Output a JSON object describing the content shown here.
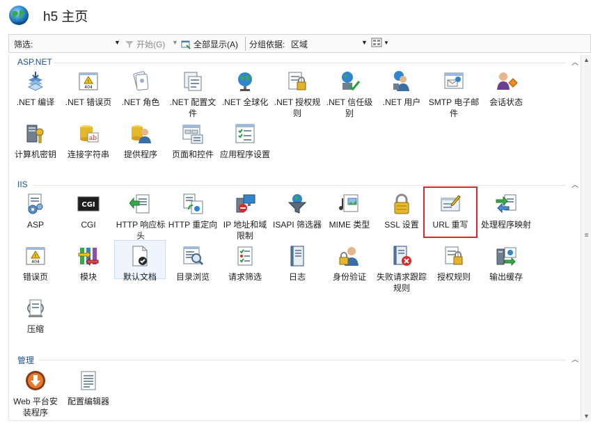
{
  "header": {
    "title": "h5 主页",
    "icon": "globe-icon"
  },
  "toolbar": {
    "filter_label": "筛选:",
    "filter_value": "",
    "start_label": "开始(G)",
    "show_all_label": "全部显示(A)",
    "group_by_label": "分组依据:",
    "group_by_value": "区域",
    "view_icon": "view-toggle-icon"
  },
  "sections": [
    {
      "title": "ASP.NET",
      "items": [
        {
          "label": ".NET 编译",
          "icon": "compile-icon"
        },
        {
          "label": ".NET 错误页",
          "icon": "error-404-icon"
        },
        {
          "label": ".NET 角色",
          "icon": "roles-icon"
        },
        {
          "label": ".NET 配置文件",
          "icon": "profile-icon"
        },
        {
          "label": ".NET 全球化",
          "icon": "globalization-icon"
        },
        {
          "label": ".NET 授权规则",
          "icon": "authorization-icon"
        },
        {
          "label": ".NET 信任级别",
          "icon": "trust-icon"
        },
        {
          "label": ".NET 用户",
          "icon": "users-icon"
        },
        {
          "label": "SMTP 电子邮件",
          "icon": "smtp-icon"
        },
        {
          "label": "会话状态",
          "icon": "session-icon"
        },
        {
          "label": "计算机密钥",
          "icon": "machine-key-icon"
        },
        {
          "label": "连接字符串",
          "icon": "connection-string-icon"
        },
        {
          "label": "提供程序",
          "icon": "providers-icon"
        },
        {
          "label": "页面和控件",
          "icon": "pages-controls-icon"
        },
        {
          "label": "应用程序设置",
          "icon": "app-settings-icon"
        }
      ]
    },
    {
      "title": "IIS",
      "items": [
        {
          "label": "ASP",
          "icon": "asp-icon"
        },
        {
          "label": "CGI",
          "icon": "cgi-icon"
        },
        {
          "label": "HTTP 响应标头",
          "icon": "http-headers-icon"
        },
        {
          "label": "HTTP 重定向",
          "icon": "http-redirect-icon"
        },
        {
          "label": "IP 地址和域限制",
          "icon": "ip-restrictions-icon"
        },
        {
          "label": "ISAPI 筛选器",
          "icon": "isapi-icon"
        },
        {
          "label": "MIME 类型",
          "icon": "mime-icon"
        },
        {
          "label": "SSL 设置",
          "icon": "ssl-icon"
        },
        {
          "label": "URL 重写",
          "icon": "url-rewrite-icon"
        },
        {
          "label": "处理程序映射",
          "icon": "handler-mappings-icon"
        },
        {
          "label": "错误页",
          "icon": "error-pages-icon"
        },
        {
          "label": "模块",
          "icon": "modules-icon"
        },
        {
          "label": "默认文档",
          "icon": "default-document-icon"
        },
        {
          "label": "目录浏览",
          "icon": "directory-browsing-icon"
        },
        {
          "label": "请求筛选",
          "icon": "request-filtering-icon"
        },
        {
          "label": "日志",
          "icon": "logging-icon"
        },
        {
          "label": "身份验证",
          "icon": "authentication-icon"
        },
        {
          "label": "失败请求跟踪规则",
          "icon": "failed-request-icon"
        },
        {
          "label": "授权规则",
          "icon": "authorization-rules-icon"
        },
        {
          "label": "输出缓存",
          "icon": "output-cache-icon"
        },
        {
          "label": "压缩",
          "icon": "compression-icon"
        }
      ]
    },
    {
      "title": "管理",
      "items": [
        {
          "label": "Web 平台安装程序",
          "icon": "web-platform-installer-icon"
        },
        {
          "label": "配置编辑器",
          "icon": "config-editor-icon"
        }
      ]
    }
  ],
  "colors": {
    "section_title": "#1e4e8c",
    "highlight_border": "#e4242b",
    "hover_bg": "#eef5fc"
  }
}
